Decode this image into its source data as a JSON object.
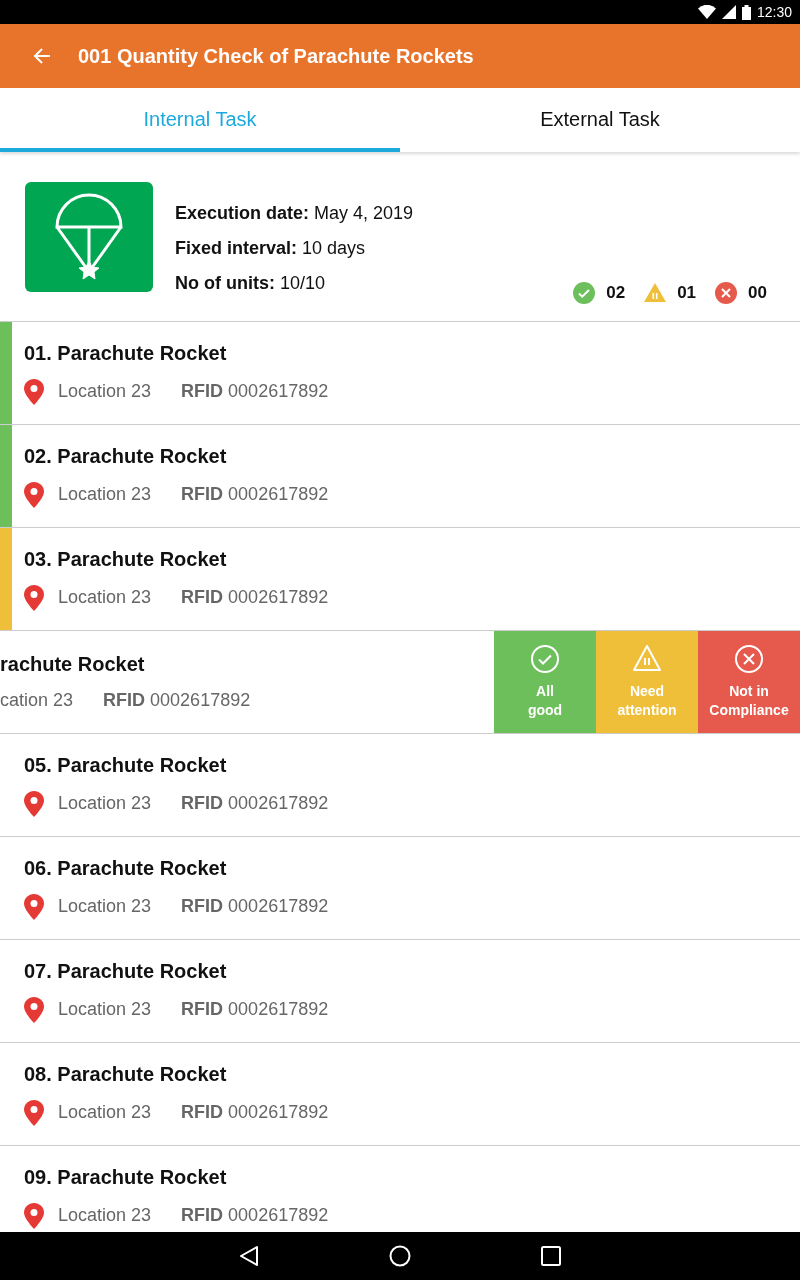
{
  "status_bar": {
    "time": "12:30"
  },
  "app_bar": {
    "title": "001 Quantity Check of Parachute Rockets"
  },
  "tabs": [
    {
      "label": "Internal Task",
      "selected": true
    },
    {
      "label": "External Task",
      "selected": false
    }
  ],
  "summary": {
    "fields": [
      {
        "label": "Execution date:",
        "value": "May 4, 2019"
      },
      {
        "label": "Fixed interval:",
        "value": "10 days"
      },
      {
        "label": "No of units:",
        "value": "10/10"
      }
    ],
    "counts": [
      {
        "kind": "good",
        "count": "02"
      },
      {
        "kind": "attention",
        "count": "01"
      },
      {
        "kind": "fail",
        "count": "00"
      }
    ]
  },
  "rows": [
    {
      "kind": "item",
      "title": "01. Parachute Rocket",
      "location": "Location 23",
      "rfid_label": "RFID",
      "rfid": "0002617892",
      "color": "#6cbf5b"
    },
    {
      "kind": "item",
      "title": "02. Parachute Rocket",
      "location": "Location 23",
      "rfid_label": "RFID",
      "rfid": "0002617892",
      "color": "#6cbf5b"
    },
    {
      "kind": "item",
      "title": "03. Parachute Rocket",
      "location": "Location 23",
      "rfid_label": "RFID",
      "rfid": "0002617892",
      "color": "#efbf3a"
    },
    {
      "kind": "swiped",
      "title": "rachute Rocket",
      "location": "cation 23",
      "rfid_label": "RFID",
      "rfid": "0002617892",
      "actions": [
        {
          "kind": "good",
          "label": "All good"
        },
        {
          "kind": "attention",
          "label": "Need attention"
        },
        {
          "kind": "fail",
          "label": "Not in Compliance"
        }
      ]
    },
    {
      "kind": "item",
      "title": "05. Parachute Rocket",
      "location": "Location 23",
      "rfid_label": "RFID",
      "rfid": "0002617892"
    },
    {
      "kind": "item",
      "title": "06. Parachute Rocket",
      "location": "Location 23",
      "rfid_label": "RFID",
      "rfid": "0002617892"
    },
    {
      "kind": "item",
      "title": "07. Parachute Rocket",
      "location": "Location 23",
      "rfid_label": "RFID",
      "rfid": "0002617892"
    },
    {
      "kind": "item",
      "title": "08. Parachute Rocket",
      "location": "Location 23",
      "rfid_label": "RFID",
      "rfid": "0002617892"
    },
    {
      "kind": "item",
      "title": "09. Parachute Rocket",
      "location": "Location 23",
      "rfid_label": "RFID",
      "rfid": "0002617892"
    }
  ]
}
